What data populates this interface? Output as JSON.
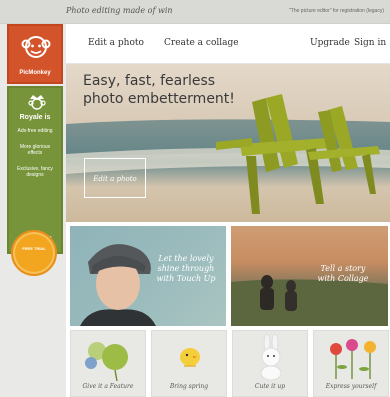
{
  "topbar": {
    "tagline": "Photo editing made of win",
    "upsell": "\"The picture editor\" for registration (legacy)"
  },
  "sidebar": {
    "logo_text": "PicMonkey",
    "royale_title": "Royale is",
    "royale_items": [
      "Ads-free editing",
      "More glorious effects",
      "Exclusive, fancy designs"
    ],
    "upgrade_label": "Upgrade now!",
    "seal_text": "FREE TRIAL"
  },
  "nav": {
    "edit_label": "Edit a photo",
    "collage_label": "Create a collage",
    "upgrade_label": "Upgrade",
    "signin_label": "Sign in"
  },
  "hero": {
    "title_line1": "Easy, fast, fearless",
    "title_line2": "photo embetterment!",
    "cta_label": "Edit a photo"
  },
  "tiles": {
    "touchup_label": "Let the lovely shine through with Touch Up",
    "collage_label": "Tell a story with Collage"
  },
  "cards": [
    {
      "label": "Give it a Feature"
    },
    {
      "label": "Bring spring"
    },
    {
      "label": "Cute it up"
    },
    {
      "label": "Express yourself"
    }
  ],
  "colors": {
    "brand_orange": "#d3542b",
    "royale_green": "#77943a",
    "chair_green": "#9aa826"
  }
}
